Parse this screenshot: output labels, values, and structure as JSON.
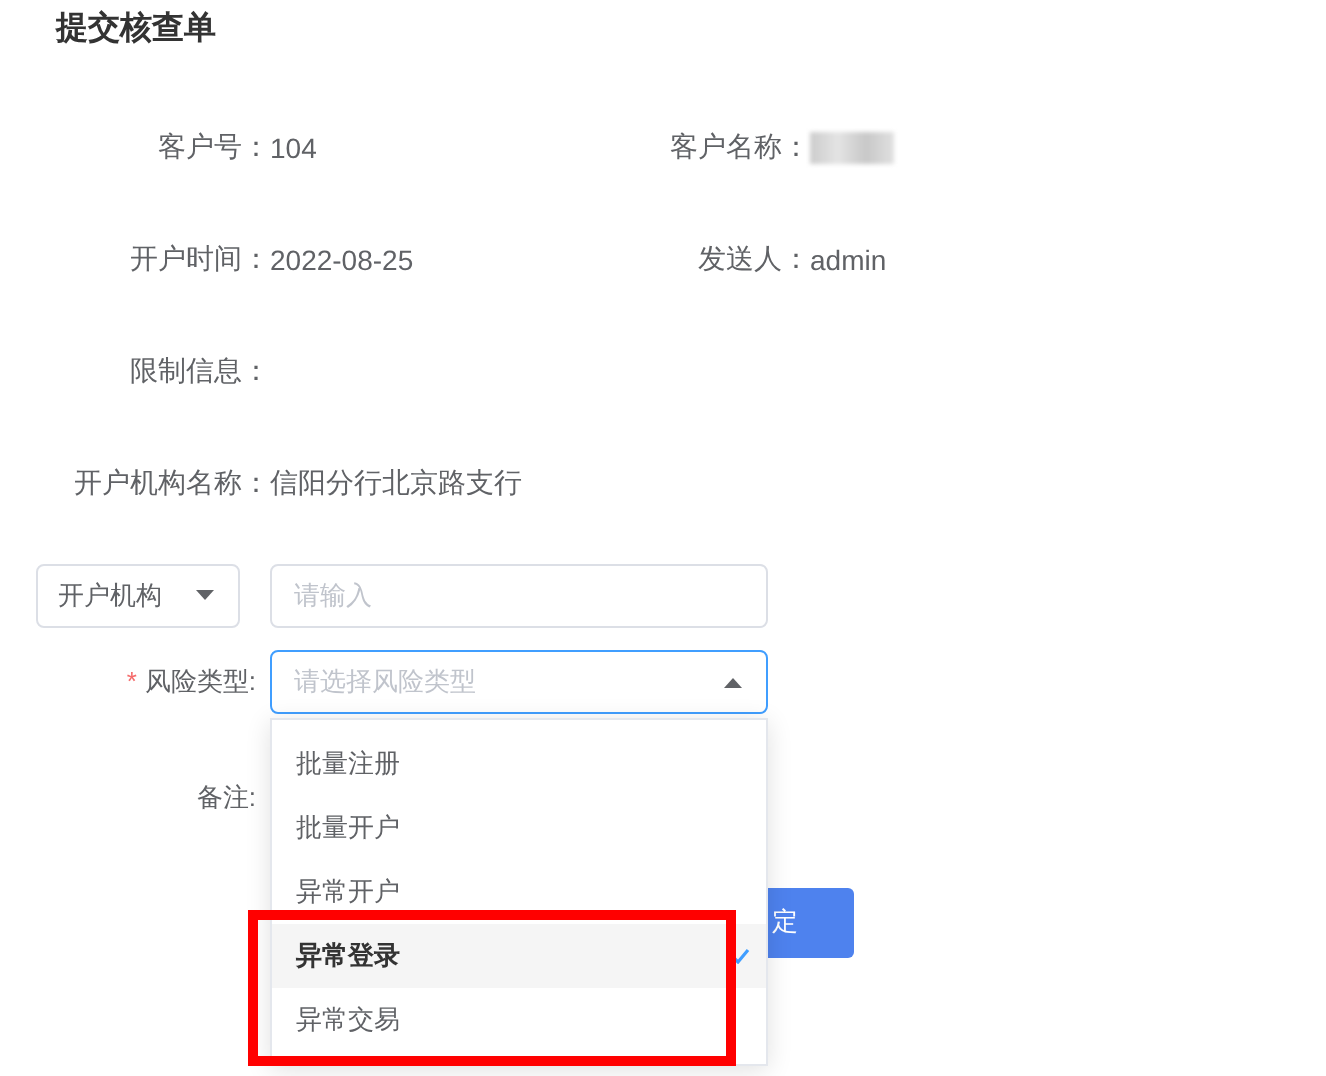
{
  "dialog": {
    "title": "提交核查单"
  },
  "info": [
    [
      {
        "label": "客户号：",
        "value": "104"
      },
      {
        "label": "客户名称：",
        "redacted": true
      }
    ],
    [
      {
        "label": "开户时间：",
        "value": "2022-08-25"
      },
      {
        "label": "发送人：",
        "value": "admin"
      }
    ],
    [
      {
        "label": "限制信息："
      }
    ],
    [
      {
        "label": "开户机构名称：",
        "value": "信阳分行北京路支行"
      }
    ]
  ],
  "filter": {
    "select": "开户机构",
    "placeholder": "请输入"
  },
  "risk": {
    "label": "风险类型:",
    "required_mark": "*",
    "placeholder": "请选择风险类型",
    "expanded": true,
    "options": [
      {
        "label": "批量注册",
        "selected": false,
        "highlighted": false
      },
      {
        "label": "批量开户",
        "selected": false,
        "highlighted": false
      },
      {
        "label": "异常开户",
        "selected": false,
        "highlighted": false
      },
      {
        "label": "异常登录",
        "selected": true,
        "highlighted": true
      },
      {
        "label": "异常交易",
        "selected": false,
        "highlighted": true
      }
    ]
  },
  "remark": {
    "label": "备注:"
  },
  "button": {
    "label": "定"
  }
}
